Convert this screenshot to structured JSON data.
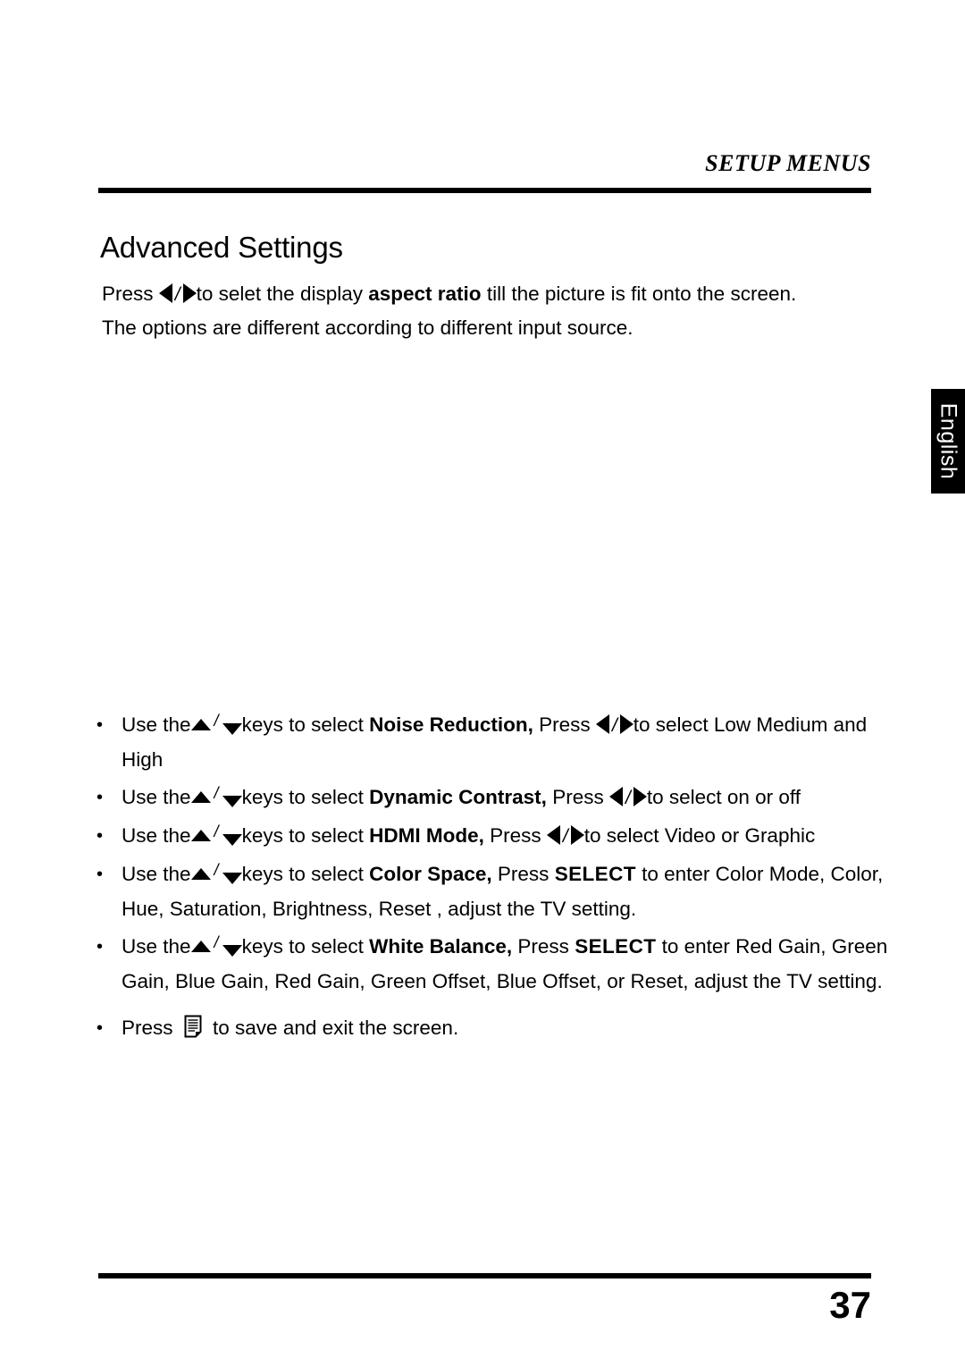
{
  "header": {
    "running_head": "SETUP MENUS"
  },
  "section": {
    "title": "Advanced Settings"
  },
  "intro": {
    "press_label": "Press",
    "text_after_arrows": "to selet the display ",
    "bold_term": "aspect ratio",
    "text_tail": " till the picture is fit onto the screen.",
    "line2": "The options are different according to different input source."
  },
  "bullets": [
    {
      "marker": "•",
      "use_the": "Use the",
      "keys_to_select": "keys to select ",
      "setting": "Noise Reduction,",
      "press": " Press ",
      "options": "to select Low Medium and High"
    },
    {
      "marker": "•",
      "use_the": "Use the",
      "keys_to_select": "keys to select ",
      "setting": "Dynamic Contrast,",
      "press": " Press ",
      "options": "to select  on or off"
    },
    {
      "marker": "•",
      "use_the": "Use the",
      "keys_to_select": "keys to select ",
      "setting": "HDMI Mode,",
      "press": " Press ",
      "options": "to select  Video or Graphic"
    },
    {
      "marker": "•",
      "use_the": "Use the",
      "keys_to_select": "keys to select ",
      "setting": "Color Space,",
      "press": " Press ",
      "select_key": "SELECT",
      "options": " to enter Color Mode, Color, Hue, Saturation, Brightness, Reset , adjust the TV setting."
    },
    {
      "marker": "•",
      "use_the": "Use the",
      "keys_to_select": "keys to select ",
      "setting": "White Balance,",
      "press": " Press ",
      "select_key": "SELECT",
      "options": " to enter Red Gain, Green Gain, Blue Gain, Red Gain, Green Offset, Blue Offset, or Reset, adjust the TV setting."
    },
    {
      "marker": "•",
      "press_label": " Press",
      "options": " to save and exit the screen."
    }
  ],
  "side_tab": {
    "language": "English"
  },
  "footer": {
    "page_number": "37"
  },
  "colors": {
    "ink": "#000000",
    "paper": "#ffffff",
    "tab_background": "#000000",
    "tab_text": "#ffffff"
  },
  "glyphs": {
    "left_arrow": "left-arrow-icon",
    "right_arrow": "right-arrow-icon",
    "up_arrow": "up-arrow-icon",
    "down_arrow": "down-arrow-icon",
    "menu_key": "menu-key-icon",
    "separator": "/"
  }
}
